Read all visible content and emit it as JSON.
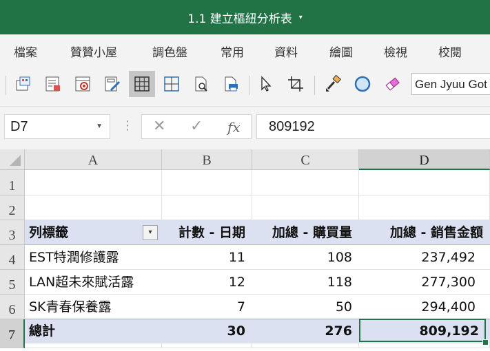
{
  "title": {
    "text": "1.1 建立樞紐分析表",
    "caret": "▾"
  },
  "menu": [
    "檔案",
    "贊贊小屋",
    "調色盤",
    "常用",
    "資料",
    "繪圖",
    "檢視",
    "校閱"
  ],
  "toolbar": {
    "icons": [
      "pivot-icon",
      "report-icon",
      "record-icon",
      "edit-form-icon",
      "all-borders-icon",
      "grid-borders-icon",
      "print-preview-icon",
      "print-icon",
      "select-cursor-icon",
      "crop-icon",
      "format-painter-icon",
      "circle-icon",
      "eraser-icon"
    ],
    "font_value": "Gen Jyuu Got"
  },
  "formula_bar": {
    "name_box": "D7",
    "cancel": "✕",
    "enter": "✓",
    "fx": "fx",
    "value": "809192",
    "dots": "⋮"
  },
  "sheet": {
    "columns": [
      "A",
      "B",
      "C",
      "D"
    ],
    "rows": [
      "1",
      "2",
      "3",
      "4",
      "5",
      "6",
      "7"
    ],
    "selected_cell": "D7",
    "pivot": {
      "headers": [
        "列標籤",
        "計數 - 日期",
        "加總 - 購買量",
        "加總 - 銷售金額"
      ],
      "rows": [
        [
          "EST特潤修護露",
          "11",
          "108",
          "237,492"
        ],
        [
          "LAN超未來賦活露",
          "12",
          "118",
          "277,300"
        ],
        [
          "SK青春保養露",
          "7",
          "50",
          "294,400"
        ]
      ],
      "total": [
        "總計",
        "30",
        "276",
        "809,192"
      ],
      "filter_icon": "▾"
    }
  },
  "colors": {
    "accent": "#217346",
    "pivot_band": "#dbe1f1"
  }
}
